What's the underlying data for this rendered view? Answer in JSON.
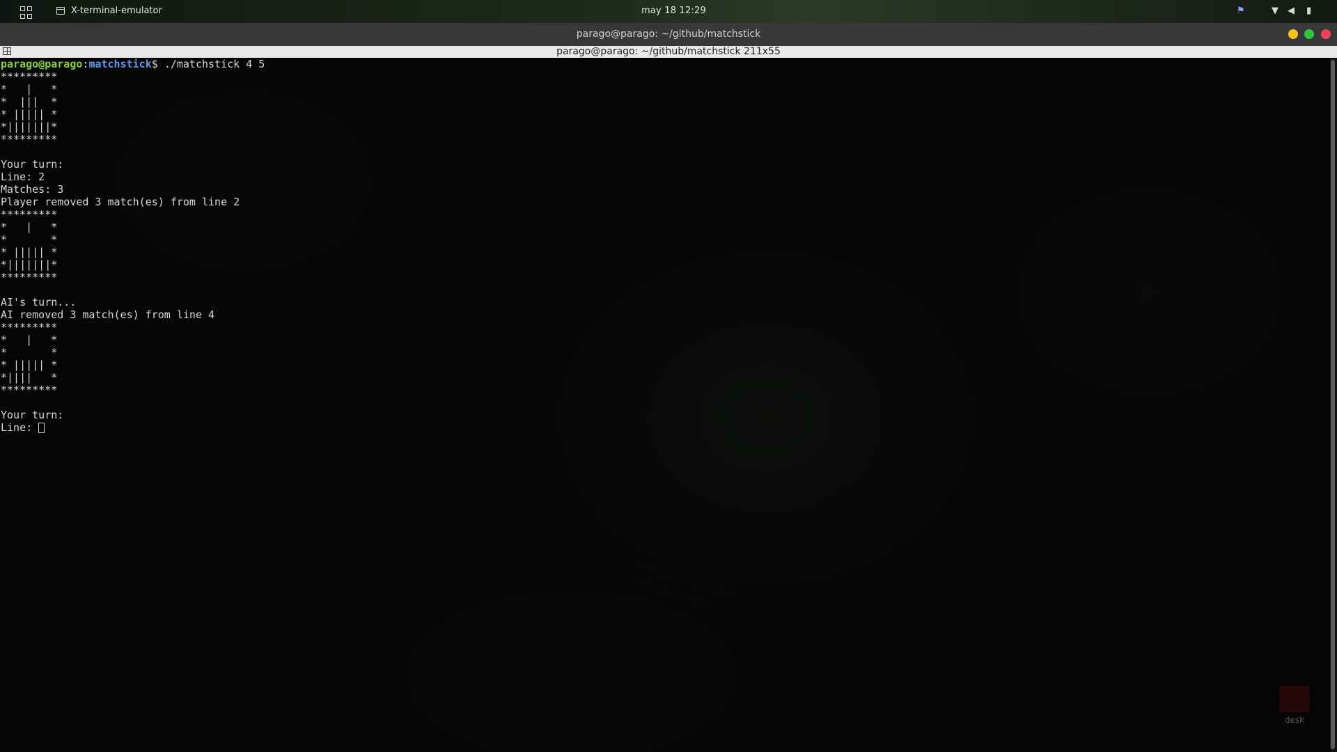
{
  "top_panel": {
    "app_name": "X-terminal-emulator",
    "clock": "may 18  12:29"
  },
  "window": {
    "title": "parago@parago: ~/github/matchstick",
    "tab_title": "parago@parago: ~/github/matchstick 211x55"
  },
  "terminal": {
    "prompt_user": "parago@parago",
    "prompt_colon": ":",
    "prompt_dir": "matchstick",
    "prompt_symbol": "$ ",
    "command": "./matchstick 4 5",
    "output": "*********\n*   |   *\n*  |||  *\n* ||||| *\n*|||||||*\n*********\n\nYour turn:\nLine: 2\nMatches: 3\nPlayer removed 3 match(es) from line 2\n*********\n*   |   *\n*       *\n* ||||| *\n*|||||||*\n*********\n\nAI's turn...\nAI removed 3 match(es) from line 4\n*********\n*   |   *\n*       *\n* ||||| *\n*||||   *\n*********\n\nYour turn:",
    "input_prompt": "Line: "
  },
  "desktop": {
    "folder_label": "desk"
  },
  "colors": {
    "prompt_user": "#87d12f",
    "prompt_dir": "#5b9bf0",
    "close": "#f0415d",
    "minimize": "#f5c21b",
    "maximize": "#2fc53b"
  }
}
